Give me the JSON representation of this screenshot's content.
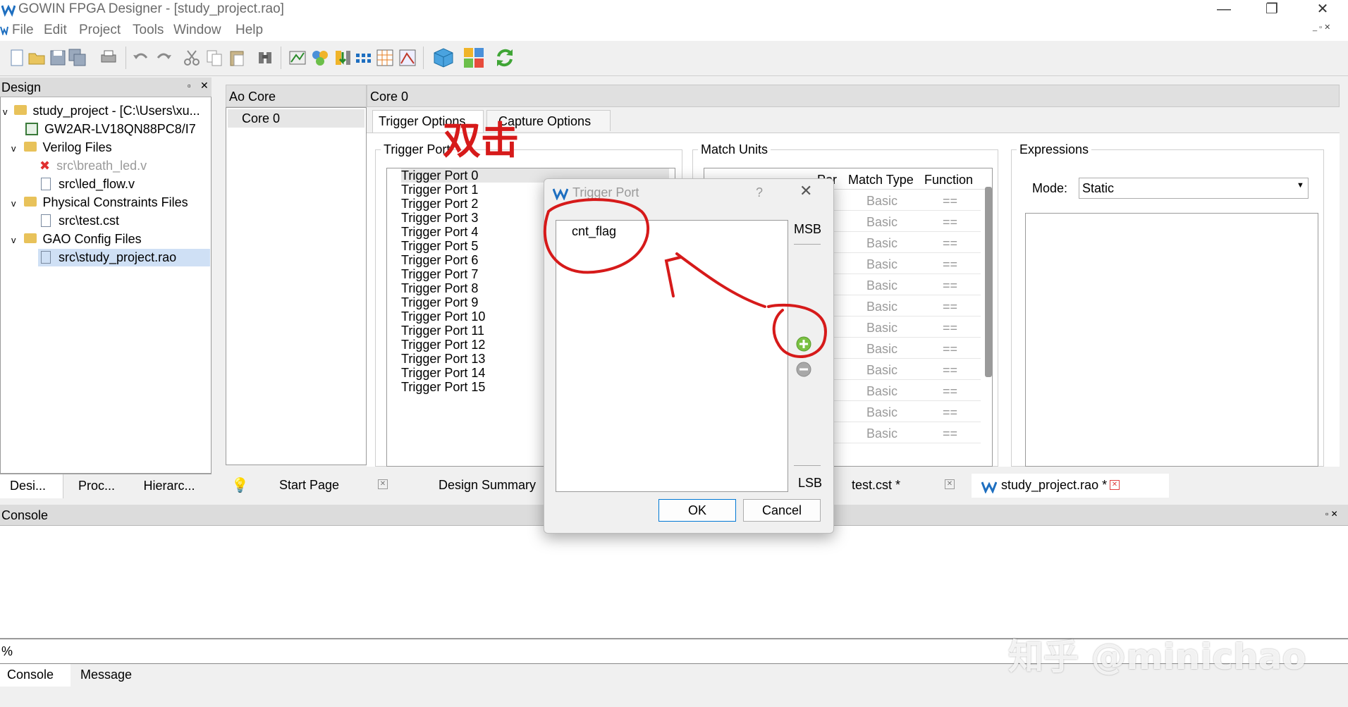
{
  "window": {
    "title": "GOWIN FPGA Designer - [study_project.rao]"
  },
  "menu": [
    "File",
    "Edit",
    "Project",
    "Tools",
    "Window",
    "Help"
  ],
  "design_panel": {
    "title": "Design",
    "tree": [
      {
        "label": "study_project - [C:\\Users\\xu...",
        "indent": 0
      },
      {
        "label": "GW2AR-LV18QN88PC8/I7",
        "indent": 1
      },
      {
        "label": "Verilog Files",
        "indent": 1
      },
      {
        "label": "src\\breath_led.v",
        "indent": 2
      },
      {
        "label": "src\\led_flow.v",
        "indent": 2
      },
      {
        "label": "Physical Constraints Files",
        "indent": 1
      },
      {
        "label": "src\\test.cst",
        "indent": 2
      },
      {
        "label": "GAO Config Files",
        "indent": 1
      },
      {
        "label": "src\\study_project.rao",
        "indent": 2
      }
    ],
    "tabs": [
      "Desi...",
      "Proc...",
      "Hierarc..."
    ]
  },
  "ao_core": {
    "header": "Ao Core",
    "item": "Core 0"
  },
  "core": {
    "header": "Core 0",
    "tabs": [
      "Trigger Options",
      "Capture Options"
    ],
    "trigger_ports_label": "Trigger Port",
    "trigger_ports": [
      "Trigger Port 0",
      "Trigger Port 1",
      "Trigger Port 2",
      "Trigger Port 3",
      "Trigger Port 4",
      "Trigger Port 5",
      "Trigger Port 6",
      "Trigger Port 7",
      "Trigger Port 8",
      "Trigger Port 9",
      "Trigger Port 10",
      "Trigger Port 11",
      "Trigger Port 12",
      "Trigger Port 13",
      "Trigger Port 14",
      "Trigger Port 15"
    ],
    "match_units_label": "Match Units",
    "match_cols": [
      "Por",
      "Match Type",
      "Function"
    ],
    "match_type": "Basic",
    "match_function": "==",
    "match_rows": 12,
    "expressions_label": "Expressions",
    "mode_label": "Mode:",
    "mode_value": "Static"
  },
  "dialog": {
    "title": "Trigger Port",
    "help": "?",
    "signal": "cnt_flag",
    "msb": "MSB",
    "lsb": "LSB",
    "ok": "OK",
    "cancel": "Cancel"
  },
  "doc_tabs": [
    "Start Page",
    "Design Summary",
    "test.cst *",
    "study_project.rao *"
  ],
  "console": {
    "title": "Console",
    "prompt": "%",
    "tabs": [
      "Console",
      "Message"
    ]
  },
  "annotation": {
    "chinese": "双击",
    "watermark": "知乎 @minichao"
  },
  "colors": {
    "annotation": "#d61a1a",
    "add_icon": "#7ac142",
    "selection": "#cfe0f5"
  }
}
